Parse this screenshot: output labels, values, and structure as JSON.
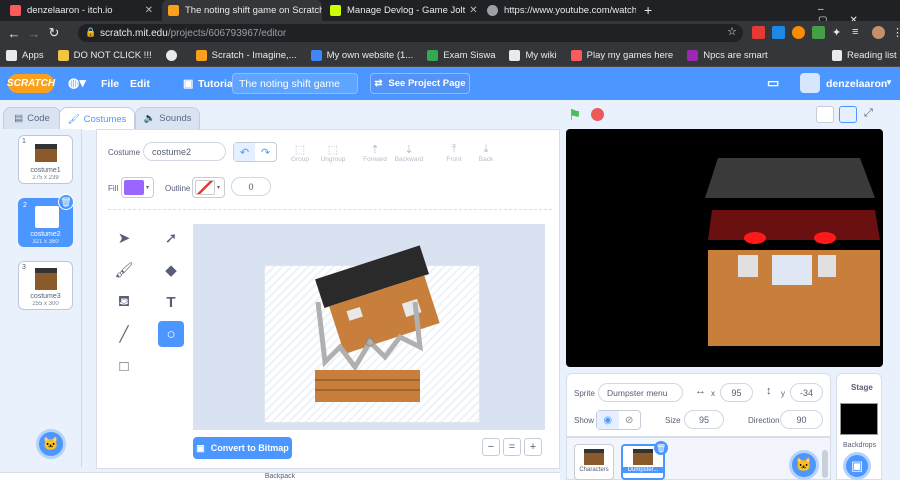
{
  "browser": {
    "tabs": [
      {
        "title": "denzelaaron - itch.io",
        "color": "#fa5c5c"
      },
      {
        "title": "The noting shift game on Scratch",
        "color": "#f9a11c"
      },
      {
        "title": "Manage Devlog - Game Jolt",
        "color": "#ccff00"
      },
      {
        "title": "https://www.youtube.com/watch",
        "color": "#9aa0a6"
      }
    ],
    "new_tab": "+",
    "url_host": "scratch.mit.edu",
    "url_path": "/projects/606793967/editor",
    "bookmarks": [
      {
        "label": "Apps",
        "color": "#e8eaed"
      },
      {
        "label": "DO NOT CLICK !!!",
        "color": "#f4c542"
      },
      {
        "label": "",
        "color": "#e8eaed"
      },
      {
        "label": "Scratch - Imagine,...",
        "color": "#f9a11c"
      },
      {
        "label": "My own website (1...",
        "color": "#4285f4"
      },
      {
        "label": "Exam Siswa",
        "color": "#34a853"
      },
      {
        "label": "My wiki",
        "color": "#e8eaed"
      },
      {
        "label": "Play my games here",
        "color": "#fa5c5c"
      },
      {
        "label": "Npcs are smart",
        "color": "#9c27b0"
      }
    ],
    "reading_list": "Reading list"
  },
  "scratch": {
    "logo": "SCRATCH",
    "menu": {
      "file": "File",
      "edit": "Edit",
      "tutorials": "Tutorials"
    },
    "project_title": "The noting shift game",
    "see_project": "See Project Page",
    "username": "denzelaaron",
    "tabs": {
      "code": "Code",
      "costumes": "Costumes",
      "sounds": "Sounds"
    },
    "costumes": [
      {
        "num": "1",
        "name": "costume1",
        "size": "275 x 239"
      },
      {
        "num": "2",
        "name": "costume2",
        "size": "321 x 360"
      },
      {
        "num": "3",
        "name": "costume3",
        "size": "255 x 300"
      }
    ],
    "paint": {
      "costume_label": "Costume",
      "costume_name": "costume2",
      "fill_label": "Fill",
      "outline_label": "Outline",
      "outline_width": "0",
      "fill_color": "#9966ff",
      "group": "Group",
      "ungroup": "Ungroup",
      "forward": "Forward",
      "backward": "Backward",
      "front": "Front",
      "back": "Back",
      "convert": "Convert to Bitmap",
      "zoom_out": "−",
      "zoom_reset": "=",
      "zoom_in": "+"
    },
    "sprite": {
      "label": "Sprite",
      "name": "Dumpster menu",
      "x_label": "x",
      "x": "95",
      "y_label": "y",
      "y": "-34",
      "show_label": "Show",
      "size_label": "Size",
      "size": "95",
      "direction_label": "Direction",
      "direction": "90",
      "thumbs": [
        "Characters",
        "Dumpster..."
      ]
    },
    "stage": {
      "label": "Stage",
      "backdrops": "Backdrops"
    },
    "backpack": "Backpack"
  }
}
